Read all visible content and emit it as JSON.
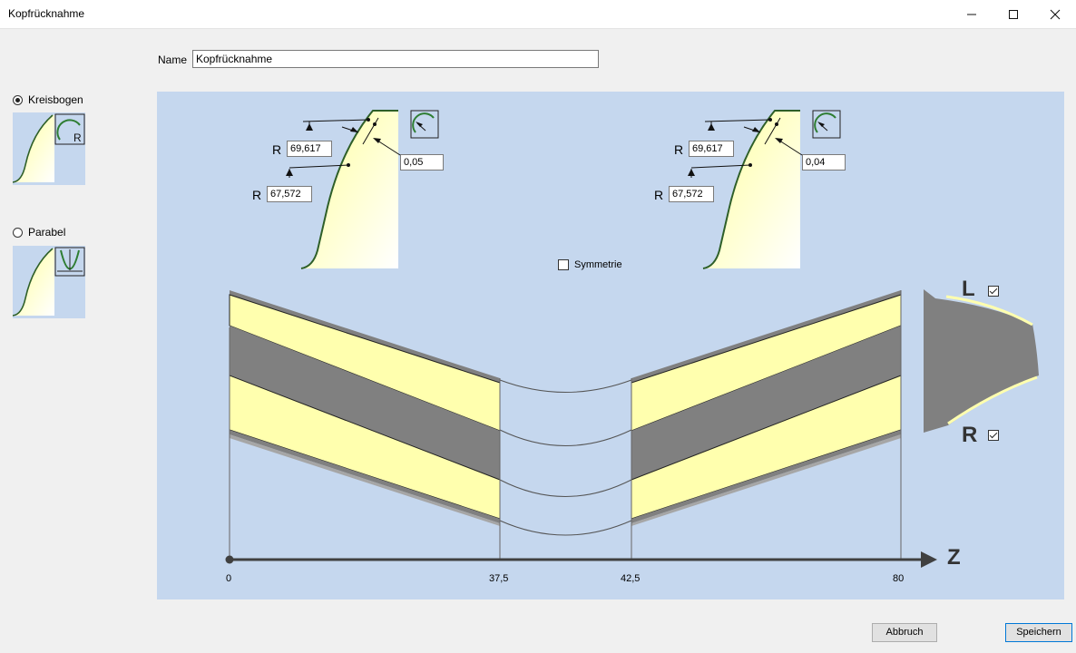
{
  "window": {
    "title": "Kopfrücknahme"
  },
  "form": {
    "name_label": "Name",
    "name_value": "Kopfrücknahme"
  },
  "options": {
    "kreisbogen_label": "Kreisbogen",
    "parabel_label": "Parabel",
    "selected": "Kreisbogen",
    "thumb_r_letter": "R"
  },
  "left_profile": {
    "r_outer": "69,617",
    "r_inner": "67,572",
    "depth": "0,05",
    "r_label": "R"
  },
  "right_profile": {
    "r_outer": "69,617",
    "r_inner": "67,572",
    "depth": "0,04",
    "r_label": "R"
  },
  "symmetrie": {
    "label": "Symmetrie",
    "checked": false
  },
  "flanks": {
    "left_letter": "L",
    "left_checked": true,
    "right_letter": "R",
    "right_checked": true
  },
  "z_axis": {
    "label": "Z",
    "ticks": [
      "0",
      "37,5",
      "42,5",
      "80"
    ]
  },
  "buttons": {
    "cancel": "Abbruch",
    "save": "Speichern"
  },
  "colors": {
    "panel_bg": "#c5d7ee",
    "yellow": "#ffffae",
    "dark_gray": "#808080",
    "accent": "#0078d7"
  }
}
